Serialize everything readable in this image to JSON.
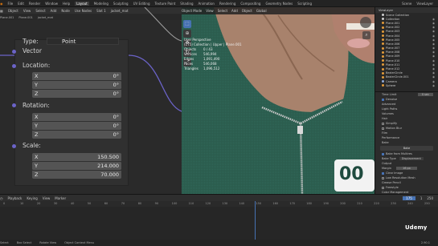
{
  "menu": {
    "items": [
      "File",
      "Edit",
      "Render",
      "Window",
      "Help"
    ],
    "workspaces": [
      "Layout",
      "Modeling",
      "Sculpting",
      "UV Editing",
      "Texture Paint",
      "Shading",
      "Animation",
      "Rendering",
      "Compositing",
      "Geometry Nodes",
      "Scripting"
    ],
    "active_workspace": "Layout",
    "scene": "Scene",
    "view_layer": "ViewLayer"
  },
  "node_editor": {
    "header": [
      "Object",
      "View",
      "Select",
      "Add",
      "Node",
      "Use Nodes",
      "Slot 1",
      "jacket_mat"
    ],
    "breadcrumb": [
      "Plane.001",
      "Plane.001",
      "jacket_mat"
    ],
    "node": {
      "type_label": "Type:",
      "type_value": "Point",
      "vector_label": "Vector",
      "location_label": "Location:",
      "rotation_label": "Rotation:",
      "scale_label": "Scale:",
      "location": [
        {
          "axis": "X",
          "value": "0"
        },
        {
          "axis": "Y",
          "value": "0°"
        },
        {
          "axis": "Z",
          "value": "0°"
        }
      ],
      "location_fixed": [
        {
          "axis": "X",
          "value": "0°"
        },
        {
          "axis": "Y",
          "value": "0°"
        },
        {
          "axis": "Z",
          "value": "0°"
        }
      ],
      "rotation": [
        {
          "axis": "X",
          "value": "0°"
        },
        {
          "axis": "Y",
          "value": "0°"
        },
        {
          "axis": "Z",
          "value": "0°"
        }
      ],
      "scale": [
        {
          "axis": "X",
          "value": "150.500"
        },
        {
          "axis": "Y",
          "value": "214.000"
        },
        {
          "axis": "Z",
          "value": "70.000"
        }
      ]
    }
  },
  "viewport": {
    "toolbar": [
      "Object Mode",
      "View",
      "Select",
      "Add",
      "Object",
      "Global"
    ],
    "title": "User Perspective",
    "collection": "(175) Collection | Upper | Plane.001",
    "stats": [
      {
        "label": "Objects",
        "value": "0 / 43"
      },
      {
        "label": "Vertices",
        "value": "546,994"
      },
      {
        "label": "Edges",
        "value": "1,091,490"
      },
      {
        "label": "Faces",
        "value": "546,068"
      },
      {
        "label": "Triangles",
        "value": "1,096,512"
      }
    ],
    "number_text": "00"
  },
  "outliner": {
    "header": "ViewLayer",
    "items": [
      "Scene Collection",
      "Collection",
      "Plane.001",
      "Plane.002",
      "Plane.003",
      "Plane.004",
      "Plane.005",
      "Plane.006",
      "Plane.007",
      "Plane.008",
      "Plane.009",
      "Plane.010",
      "Plane.011",
      "Plane.012",
      "BezierCircle",
      "BezierCircle.001",
      "Camera",
      "Sphere"
    ]
  },
  "properties": {
    "rows": [
      "Time Limit",
      "Denoise",
      "Advanced",
      "Light Paths",
      "Volumes",
      "Hair",
      "Simplify",
      "Motion Blur",
      "Film",
      "Performance",
      "Bake",
      "Bake from Multires",
      "Bake Type",
      "Output",
      "Margin",
      "Clear Image",
      "Low Resolution Mesh",
      "Grease Pencil",
      "Freestyle",
      "Color Management"
    ],
    "time_limit_value": "0 sec",
    "bake_button": "Bake",
    "bake_type": "Displacement",
    "margin_value": "16 px"
  },
  "timeline": {
    "header": [
      "Playback",
      "Keying",
      "View",
      "Marker"
    ],
    "frames": [
      "0",
      "10",
      "20",
      "30",
      "40",
      "50",
      "60",
      "70",
      "80",
      "90",
      "100",
      "110",
      "120",
      "130",
      "140",
      "150",
      "160",
      "170",
      "180",
      "190",
      "200",
      "210",
      "220",
      "230",
      "240",
      "250"
    ],
    "current_frame": "175",
    "start": "1",
    "end": "250"
  },
  "status": {
    "items": [
      "Select",
      "Box Select",
      "Rotate View",
      "Object Context Menu"
    ],
    "version": "2.90.1",
    "watermark": "Udemy"
  },
  "colors": {
    "accent": "#4772b3",
    "socket": "#6b63c8",
    "jacket": "#2b5c4d"
  }
}
